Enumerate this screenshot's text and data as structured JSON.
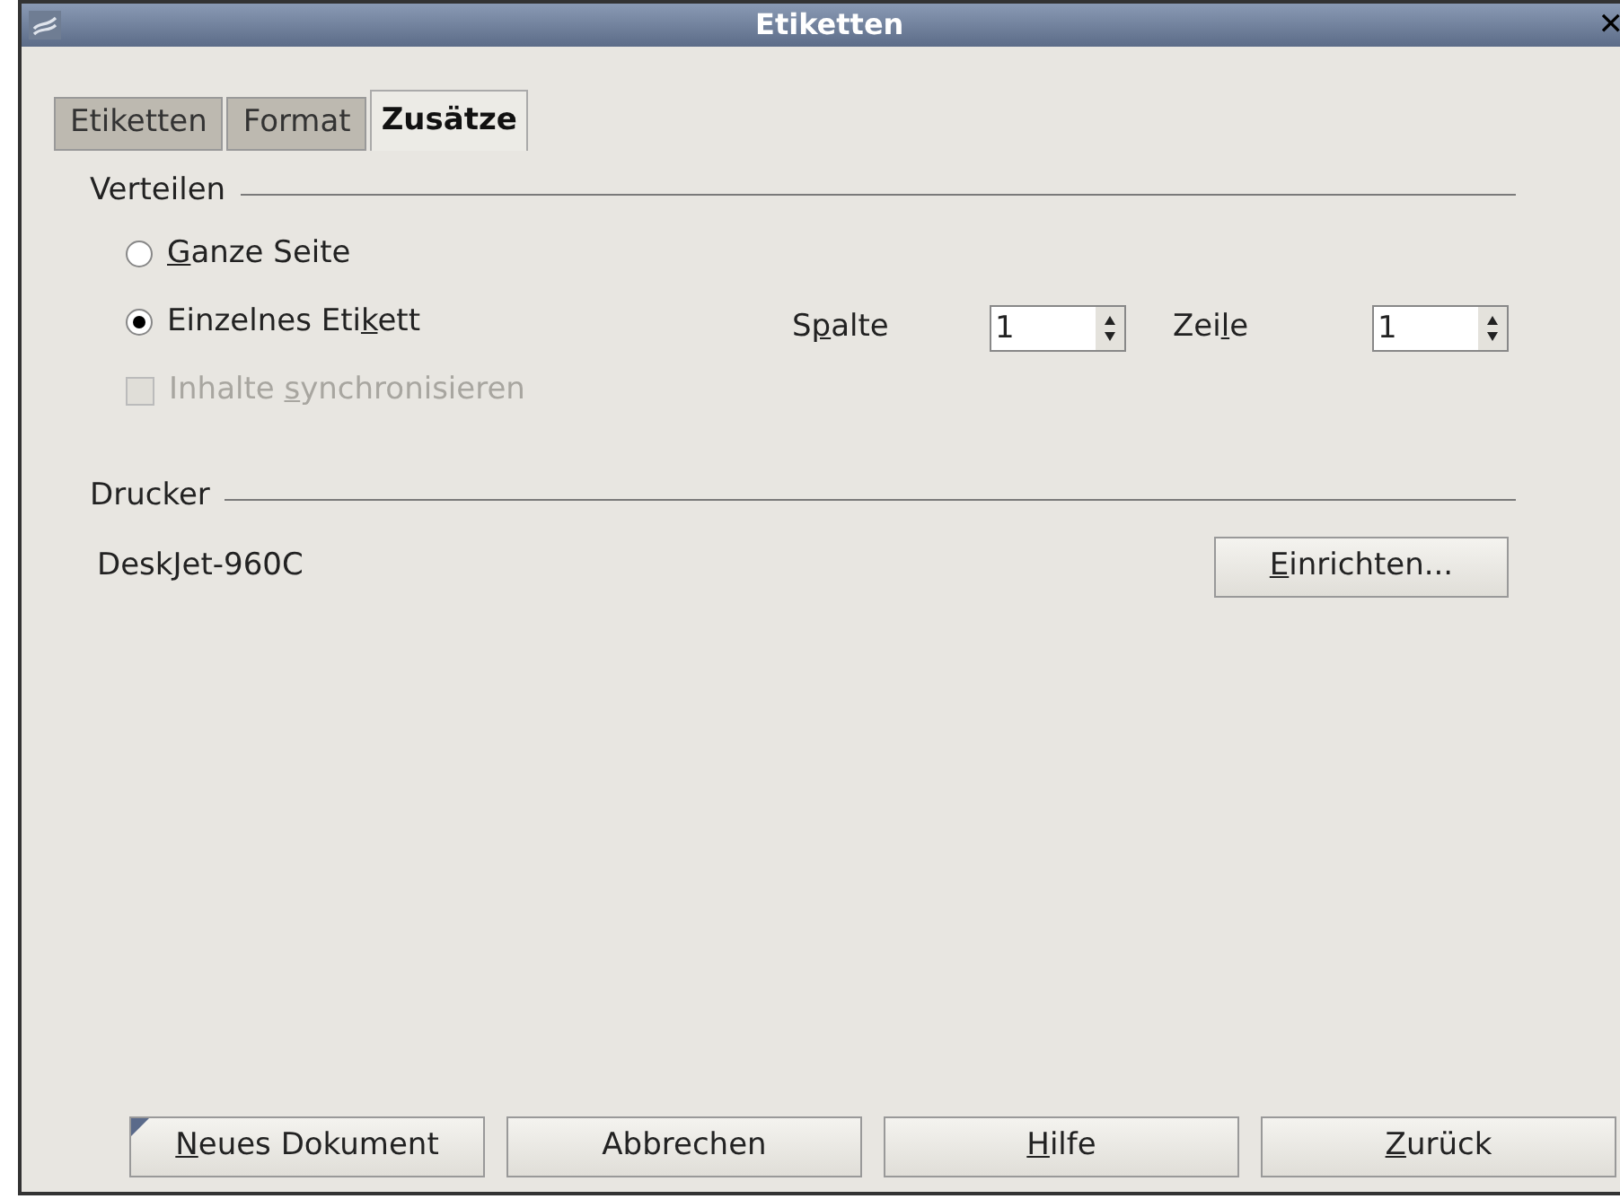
{
  "window": {
    "title": "Etiketten",
    "close": "✕"
  },
  "tabs": [
    {
      "label": "Etiketten",
      "selected": false
    },
    {
      "label": "Format",
      "selected": false
    },
    {
      "label": "Zusätze",
      "selected": true
    }
  ],
  "distribute": {
    "heading": "Verteilen",
    "options": [
      {
        "kind": "radio",
        "key": "G",
        "post": "anze Seite",
        "selected": false,
        "disabled": false
      },
      {
        "kind": "radio",
        "pre": "Einzelnes Eti",
        "key": "k",
        "post": "ett",
        "selected": true,
        "disabled": false
      },
      {
        "kind": "checkbox",
        "pre": "Inhalte ",
        "key": "s",
        "post": "ynchronisieren",
        "checked": false,
        "disabled": true
      }
    ],
    "spinners": [
      {
        "pre": "S",
        "key": "p",
        "post": "alte",
        "value": "1"
      },
      {
        "pre": "Zei",
        "key": "l",
        "post": "e",
        "value": "1"
      }
    ]
  },
  "printer": {
    "heading": "Drucker",
    "name": "DeskJet-960C",
    "setup_button": {
      "key": "E",
      "post": "inrichten..."
    }
  },
  "buttons": [
    {
      "key": "N",
      "post": "eues Dokument",
      "default": true
    },
    {
      "pre": "Abbrechen",
      "default": false
    },
    {
      "key": "H",
      "post": "ilfe",
      "default": false
    },
    {
      "key": "Z",
      "post": "urück",
      "default": false
    }
  ]
}
